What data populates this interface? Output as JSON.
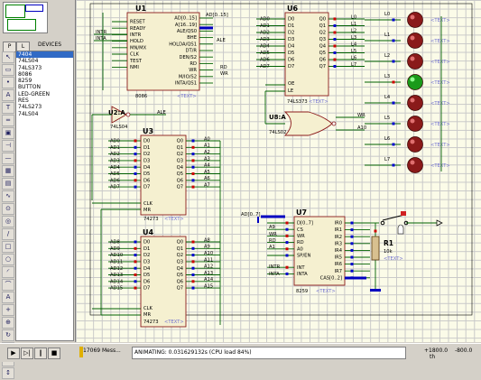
{
  "sidebar": {
    "pick_label": "P",
    "library_label": "L",
    "devices_header": "DEVICES",
    "devices": [
      "7404",
      "74LS04",
      "74LS373",
      "8086",
      "8259",
      "BUTTON",
      "LED-GREEN",
      "RES",
      "74LS273",
      "74LS04"
    ],
    "selected_index": 0,
    "tool_icons": [
      "arrow-icon",
      "component-icon",
      "junction-icon",
      "label-icon",
      "text-icon",
      "bus-icon",
      "subcircuit-icon",
      "terminal-icon",
      "pin-icon",
      "graph-icon",
      "tape-icon",
      "generator-icon",
      "probe-icon",
      "meter-icon",
      "line-icon",
      "box-icon",
      "circle-icon",
      "arc-icon",
      "path-icon",
      "text2-icon",
      "symbol-icon",
      "marker-icon",
      "rotate-cw-icon",
      "rotate-ccw-icon",
      "mirror-x-icon",
      "mirror-y-icon"
    ]
  },
  "status": {
    "messages": "17069 Mess...",
    "animating": "ANIMATING: 0.031629132s (CPU load 84%)",
    "x_coord": "+1800.0",
    "y_coord": "-800.0",
    "unit": "th"
  },
  "schematic": {
    "u1": {
      "ref": "U1",
      "part": "8086",
      "left_pins": [
        "RESET",
        "READY",
        "INTR",
        "HOLD",
        "MN/MX",
        "CLK",
        "TEST",
        "NMI"
      ],
      "right_pins": [
        "AD[0..15]",
        "A[16..19]",
        "ALE/QS0",
        "BHE",
        "HOLDA/QS1",
        "DT/R",
        "DEN/S2",
        "RD",
        "WR",
        "M/IO/S2",
        "INTA/QS1"
      ],
      "net_labels": [
        "AD[0..15]",
        "ALE",
        "RD",
        "WR",
        "INTA",
        "INTR"
      ]
    },
    "u6": {
      "ref": "U6",
      "part": "74LS373",
      "inputs": [
        "AD0",
        "AD1",
        "AD2",
        "AD3",
        "AD4",
        "AD5",
        "AD6",
        "AD7"
      ],
      "outputs": [
        "Q0",
        "Q1",
        "Q2",
        "Q3",
        "Q4",
        "Q5",
        "Q6",
        "Q7"
      ],
      "pins": [
        "D0",
        "D1",
        "D2",
        "D3",
        "D4",
        "D5",
        "D6",
        "D7",
        "OE",
        "LE"
      ],
      "out_labels": [
        "L0",
        "L1",
        "L2",
        "L3",
        "L4",
        "L5",
        "L6",
        "L7"
      ]
    },
    "u2": {
      "ref": "U2:A",
      "part": "74LS04",
      "net": "ALE"
    },
    "u8": {
      "ref": "U8:A",
      "part": "74LS02",
      "inputs": [
        "WR",
        "A10"
      ]
    },
    "u3": {
      "ref": "U3",
      "part": "74273",
      "inputs": [
        "AD0",
        "AD1",
        "AD2",
        "AD3",
        "AD4",
        "AD5",
        "AD6",
        "AD7"
      ],
      "outputs": [
        "A0",
        "A1",
        "A2",
        "A3",
        "A4",
        "A5",
        "A6",
        "A7"
      ],
      "pins": [
        "D0",
        "D1",
        "D2",
        "D3",
        "D4",
        "D5",
        "D6",
        "D7",
        "Q0",
        "Q1",
        "Q2",
        "Q3",
        "Q4",
        "Q5",
        "Q6",
        "Q7",
        "CLK",
        "MR"
      ]
    },
    "u4": {
      "ref": "U4",
      "part": "74273",
      "inputs": [
        "AD8",
        "AD9",
        "AD10",
        "AD11",
        "AD12",
        "AD13",
        "AD14",
        "AD15"
      ],
      "outputs": [
        "A8",
        "A9",
        "A10",
        "A11",
        "A12",
        "A13",
        "A14",
        "A15"
      ],
      "pins": [
        "D0",
        "D1",
        "D2",
        "D3",
        "D4",
        "D5",
        "D6",
        "D7",
        "Q0",
        "Q1",
        "Q2",
        "Q3",
        "Q4",
        "Q5",
        "Q6",
        "Q7",
        "CLK",
        "MR"
      ]
    },
    "u7": {
      "ref": "U7",
      "part": "8259",
      "left_pins": [
        "D[0..7]",
        "CS",
        "WR",
        "RD",
        "A0",
        "SP/EN",
        "INT",
        "INTA"
      ],
      "right_pins": [
        "IR0",
        "IR1",
        "IR2",
        "IR3",
        "IR4",
        "IR5",
        "IR6",
        "IR7",
        "CAS[0..2]"
      ],
      "net_labels": [
        "AD[0..7]",
        "A9",
        "WR",
        "RD",
        "A1",
        "INTR",
        "INTA"
      ]
    },
    "r1": {
      "ref": "R1",
      "value": "10k"
    },
    "text_placeholder": "<TEXT>",
    "led_labels": [
      "L0",
      "L1",
      "L2",
      "L3",
      "L4",
      "L5",
      "L6",
      "L7"
    ],
    "lit_led_index": 3
  }
}
